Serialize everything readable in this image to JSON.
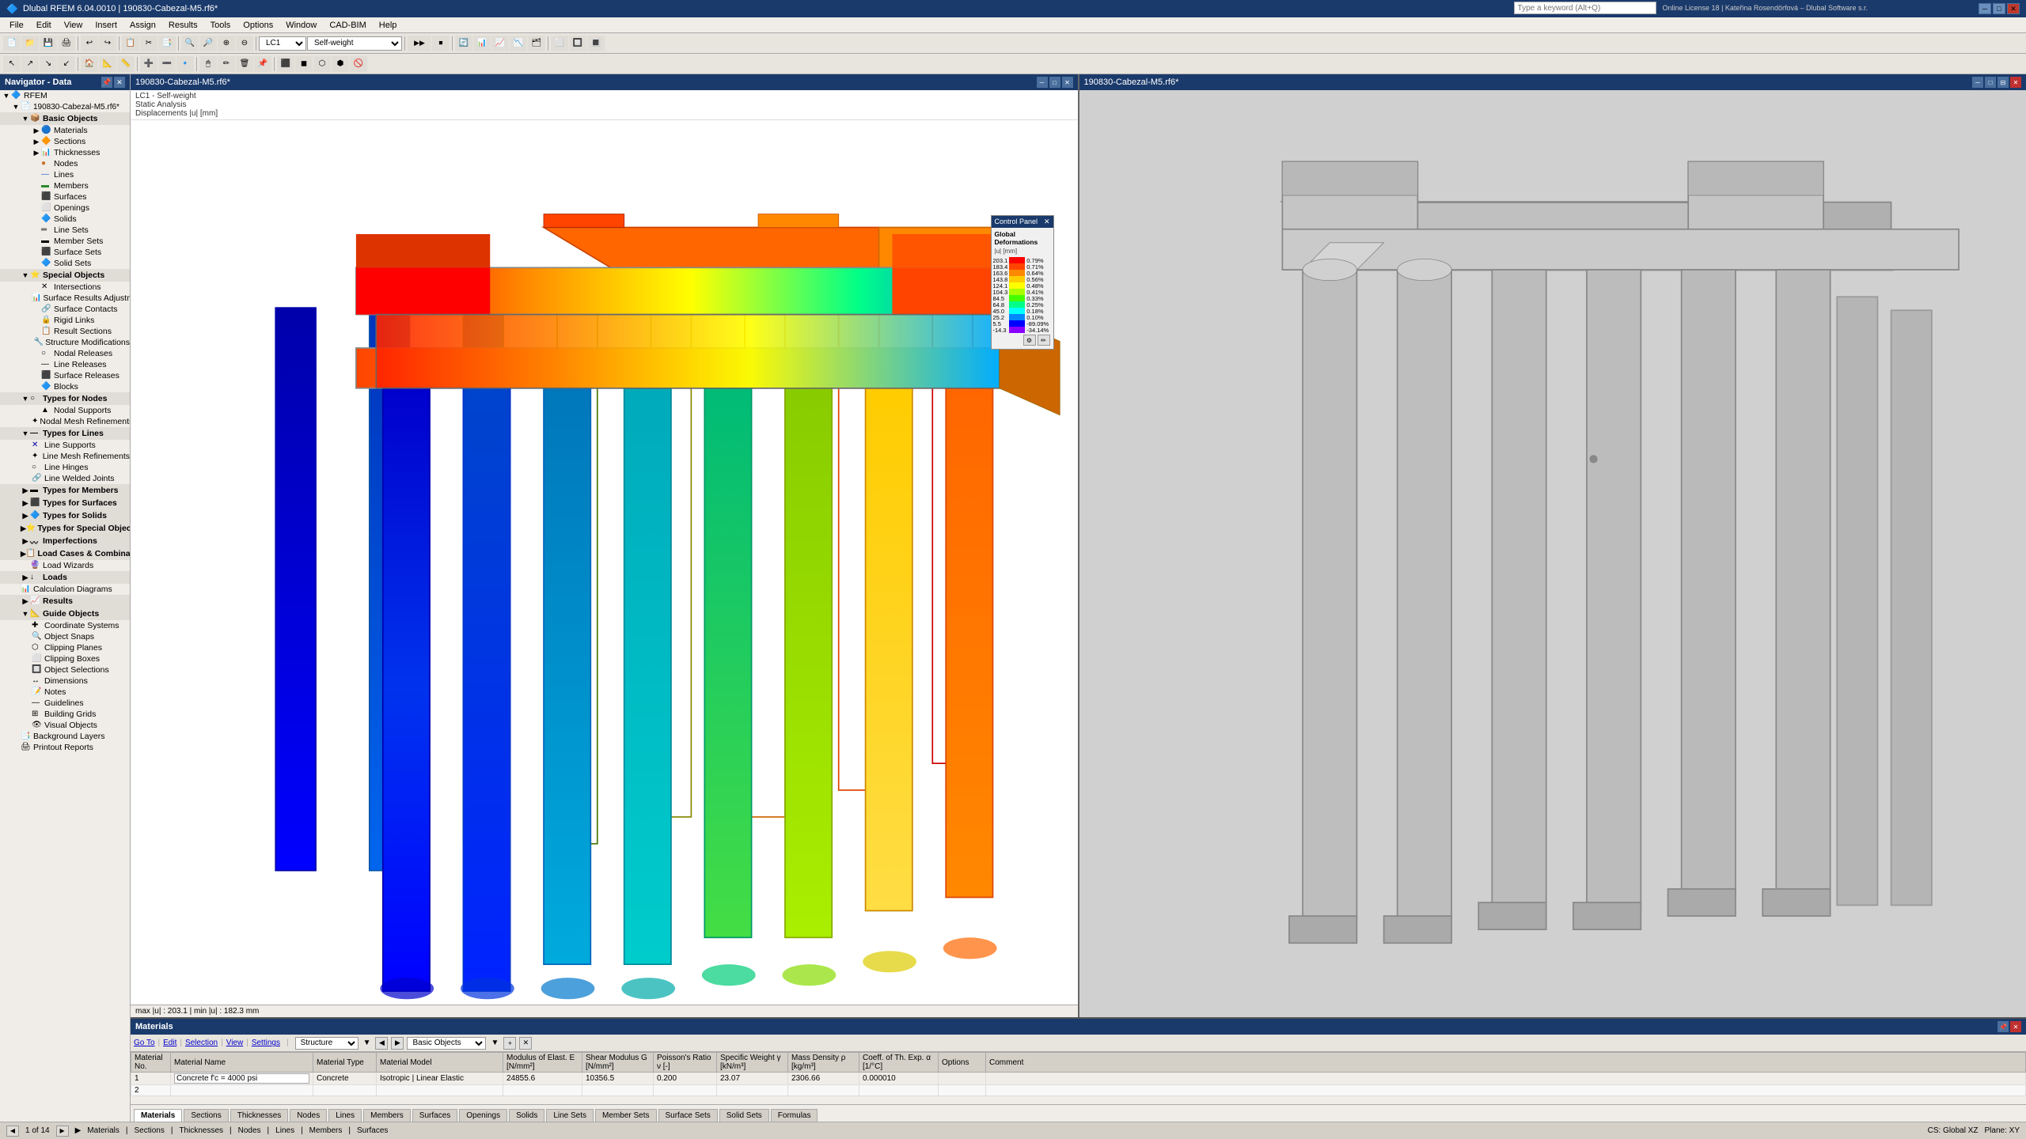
{
  "app": {
    "title": "Dlubal RFEM 6.04.0010 | 190830-Cabezal-M5.rf6*",
    "version": "Dlubal RFEM 6.04.0010"
  },
  "titlebar": {
    "minimize": "─",
    "maximize": "□",
    "close": "✕"
  },
  "menu": {
    "items": [
      "File",
      "Edit",
      "View",
      "Insert",
      "Assign",
      "Results",
      "Tools",
      "Options",
      "Window",
      "CAD-BIM",
      "Help"
    ]
  },
  "search": {
    "placeholder": "Type a keyword (Alt+Q)",
    "license": "Online License 18 | Kateřina Rosendörfová – Dlubal Software s.r."
  },
  "navigator": {
    "title": "Navigator - Data",
    "rfem_label": "RFEM",
    "file_label": "190830-Cabezal-M5.rf6*",
    "basic_objects": "Basic Objects",
    "tree_items": [
      {
        "id": "rfem",
        "label": "RFEM",
        "level": 0,
        "expanded": true,
        "type": "root"
      },
      {
        "id": "file",
        "label": "190830-Cabezal-M5.rf6*",
        "level": 1,
        "expanded": true,
        "type": "file"
      },
      {
        "id": "basic-objects",
        "label": "Basic Objects",
        "level": 2,
        "expanded": true,
        "type": "folder"
      },
      {
        "id": "materials",
        "label": "Materials",
        "level": 3,
        "expanded": false,
        "type": "item"
      },
      {
        "id": "sections",
        "label": "Sections",
        "level": 3,
        "expanded": false,
        "type": "item"
      },
      {
        "id": "thicknesses",
        "label": "Thicknesses",
        "level": 3,
        "expanded": false,
        "type": "item"
      },
      {
        "id": "nodes",
        "label": "Nodes",
        "level": 3,
        "expanded": false,
        "type": "item"
      },
      {
        "id": "lines",
        "label": "Lines",
        "level": 3,
        "expanded": false,
        "type": "item"
      },
      {
        "id": "members",
        "label": "Members",
        "level": 3,
        "expanded": false,
        "type": "item"
      },
      {
        "id": "surfaces",
        "label": "Surfaces",
        "level": 3,
        "expanded": false,
        "type": "item"
      },
      {
        "id": "openings",
        "label": "Openings",
        "level": 3,
        "expanded": false,
        "type": "item"
      },
      {
        "id": "solids",
        "label": "Solids",
        "level": 3,
        "expanded": false,
        "type": "item"
      },
      {
        "id": "line-sets",
        "label": "Line Sets",
        "level": 3,
        "expanded": false,
        "type": "item"
      },
      {
        "id": "member-sets",
        "label": "Member Sets",
        "level": 3,
        "expanded": false,
        "type": "item"
      },
      {
        "id": "surface-sets",
        "label": "Surface Sets",
        "level": 3,
        "expanded": false,
        "type": "item"
      },
      {
        "id": "solid-sets",
        "label": "Solid Sets",
        "level": 3,
        "expanded": false,
        "type": "item"
      },
      {
        "id": "special-objects",
        "label": "Special Objects",
        "level": 2,
        "expanded": true,
        "type": "folder"
      },
      {
        "id": "intersections",
        "label": "Intersections",
        "level": 3,
        "expanded": false,
        "type": "item"
      },
      {
        "id": "surface-results-adj",
        "label": "Surface Results Adjustments",
        "level": 3,
        "expanded": false,
        "type": "item"
      },
      {
        "id": "surface-contacts",
        "label": "Surface Contacts",
        "level": 3,
        "expanded": false,
        "type": "item"
      },
      {
        "id": "rigid-links",
        "label": "Rigid Links",
        "level": 3,
        "expanded": false,
        "type": "item"
      },
      {
        "id": "result-sections",
        "label": "Result Sections",
        "level": 3,
        "expanded": false,
        "type": "item"
      },
      {
        "id": "structure-mods",
        "label": "Structure Modifications",
        "level": 3,
        "expanded": false,
        "type": "item"
      },
      {
        "id": "nodal-releases",
        "label": "Nodal Releases",
        "level": 3,
        "expanded": false,
        "type": "item"
      },
      {
        "id": "line-releases",
        "label": "Line Releases",
        "level": 3,
        "expanded": false,
        "type": "item"
      },
      {
        "id": "surface-releases",
        "label": "Surface Releases",
        "level": 3,
        "expanded": false,
        "type": "item"
      },
      {
        "id": "blocks",
        "label": "Blocks",
        "level": 3,
        "expanded": false,
        "type": "item"
      },
      {
        "id": "types-for-nodes",
        "label": "Types for Nodes",
        "level": 2,
        "expanded": true,
        "type": "folder"
      },
      {
        "id": "nodal-supports",
        "label": "Nodal Supports",
        "level": 3,
        "expanded": false,
        "type": "item"
      },
      {
        "id": "nodal-mesh-ref",
        "label": "Nodal Mesh Refinements",
        "level": 3,
        "expanded": false,
        "type": "item"
      },
      {
        "id": "types-for-lines",
        "label": "Types for Lines",
        "level": 2,
        "expanded": true,
        "type": "folder"
      },
      {
        "id": "line-supports",
        "label": "Line Supports",
        "level": 3,
        "expanded": false,
        "type": "item"
      },
      {
        "id": "line-mesh-ref",
        "label": "Line Mesh Refinements",
        "level": 3,
        "expanded": false,
        "type": "item"
      },
      {
        "id": "line-hinges",
        "label": "Line Hinges",
        "level": 3,
        "expanded": false,
        "type": "item"
      },
      {
        "id": "line-welded-joints",
        "label": "Line Welded Joints",
        "level": 3,
        "expanded": false,
        "type": "item"
      },
      {
        "id": "types-for-members",
        "label": "Types for Members",
        "level": 2,
        "expanded": false,
        "type": "folder"
      },
      {
        "id": "types-for-surfaces",
        "label": "Types for Surfaces",
        "level": 2,
        "expanded": false,
        "type": "folder"
      },
      {
        "id": "types-for-solids",
        "label": "Types for Solids",
        "level": 2,
        "expanded": false,
        "type": "folder"
      },
      {
        "id": "types-for-special",
        "label": "Types for Special Objects",
        "level": 2,
        "expanded": false,
        "type": "folder"
      },
      {
        "id": "imperfections",
        "label": "Imperfections",
        "level": 2,
        "expanded": false,
        "type": "folder"
      },
      {
        "id": "load-cases",
        "label": "Load Cases & Combinations",
        "level": 2,
        "expanded": false,
        "type": "folder"
      },
      {
        "id": "load-wizards",
        "label": "Load Wizards",
        "level": 2,
        "expanded": false,
        "type": "item"
      },
      {
        "id": "loads",
        "label": "Loads",
        "level": 2,
        "expanded": false,
        "type": "folder"
      },
      {
        "id": "calc-diagrams",
        "label": "Calculation Diagrams",
        "level": 2,
        "expanded": false,
        "type": "item"
      },
      {
        "id": "results",
        "label": "Results",
        "level": 2,
        "expanded": false,
        "type": "folder"
      },
      {
        "id": "guide-objects",
        "label": "Guide Objects",
        "level": 2,
        "expanded": true,
        "type": "folder"
      },
      {
        "id": "coord-systems",
        "label": "Coordinate Systems",
        "level": 3,
        "expanded": false,
        "type": "item"
      },
      {
        "id": "object-snaps",
        "label": "Object Snaps",
        "level": 3,
        "expanded": false,
        "type": "item"
      },
      {
        "id": "clipping-planes",
        "label": "Clipping Planes",
        "level": 3,
        "expanded": false,
        "type": "item"
      },
      {
        "id": "clipping-boxes",
        "label": "Clipping Boxes",
        "level": 3,
        "expanded": false,
        "type": "item"
      },
      {
        "id": "object-selections",
        "label": "Object Selections",
        "level": 3,
        "expanded": false,
        "type": "item"
      },
      {
        "id": "dimensions",
        "label": "Dimensions",
        "level": 3,
        "expanded": false,
        "type": "item"
      },
      {
        "id": "notes",
        "label": "Notes",
        "level": 3,
        "expanded": false,
        "type": "item"
      },
      {
        "id": "guidelines",
        "label": "Guidelines",
        "level": 3,
        "expanded": false,
        "type": "item"
      },
      {
        "id": "building-grids",
        "label": "Building Grids",
        "level": 3,
        "expanded": false,
        "type": "item"
      },
      {
        "id": "visual-objects",
        "label": "Visual Objects",
        "level": 3,
        "expanded": false,
        "type": "item"
      },
      {
        "id": "background-layers",
        "label": "Background Layers",
        "level": 2,
        "expanded": false,
        "type": "item"
      },
      {
        "id": "printout-reports",
        "label": "Printout Reports",
        "level": 2,
        "expanded": false,
        "type": "item"
      }
    ]
  },
  "viewport_left": {
    "title": "190830-Cabezal-M5.rf6*",
    "lc": "LC1 - Self-weight",
    "analysis_type": "Static Analysis",
    "result_type": "Displacements |u| [mm]",
    "status": "max |u| : 203.1 | min |u| : 182.3 mm"
  },
  "viewport_right": {
    "title": "190830-Cabezal-M5.rf6*"
  },
  "control_panel": {
    "title": "Control Panel",
    "subtitle": "Global Deformations",
    "subtitle2": "|u| [mm]",
    "colors": [
      {
        "label": "203.1",
        "value": "0.79%",
        "color": "#ff0000"
      },
      {
        "label": "183.4",
        "value": "0.71%",
        "color": "#ff4400"
      },
      {
        "label": "163.6",
        "value": "0.64%",
        "color": "#ff8800"
      },
      {
        "label": "143.8",
        "value": "0.56%",
        "color": "#ffcc00"
      },
      {
        "label": "124.1",
        "value": "0.48%",
        "color": "#ffff00"
      },
      {
        "label": "104.3",
        "value": "0.41%",
        "color": "#aaff00"
      },
      {
        "label": "84.5",
        "value": "0.33%",
        "color": "#44ff00"
      },
      {
        "label": "64.8",
        "value": "0.25%",
        "color": "#00ff88"
      },
      {
        "label": "45.0",
        "value": "0.18%",
        "color": "#00ffff"
      },
      {
        "label": "25.2",
        "value": "0.10%",
        "color": "#0088ff"
      },
      {
        "label": "5.5",
        "value": "-89.09%",
        "color": "#0000ff"
      },
      {
        "label": "-14.3",
        "value": "-34.14%",
        "color": "#8800ff"
      }
    ]
  },
  "toolbar": {
    "lc_combo": "LC1",
    "lc_label": "Self-weight",
    "toolbar1_btns": [
      "📁",
      "💾",
      "🖨",
      "↩",
      "↪"
    ],
    "toolbar2_btns": [
      "▶",
      "⏸",
      "⏹"
    ]
  },
  "materials_panel": {
    "title": "Materials",
    "goto": "Go To",
    "edit": "Edit",
    "selection": "Selection",
    "view": "View",
    "settings": "Settings",
    "filter_combo": "Structure",
    "filter_combo2": "Basic Objects",
    "columns": [
      "Material No.",
      "Material Name",
      "Material Type",
      "Material Model",
      "Modulus of Elast. E [N/mm²]",
      "Shear Modulus G [N/mm²]",
      "Poisson's Ratio ν [-]",
      "Specific Weight γ [kN/m³]",
      "Mass Density ρ [kg/m³]",
      "Coeff. of Th. Exp. α [1/°C]",
      "Options",
      "Comment"
    ],
    "rows": [
      {
        "no": "1",
        "name": "Concrete f'c = 4000 psi",
        "type": "Concrete",
        "model": "Isotropic | Linear Elastic",
        "E": "24855.6",
        "G": "10356.5",
        "nu": "0.200",
        "gamma": "23.07",
        "rho": "2306.66",
        "alpha": "0.000010",
        "options": "",
        "comment": ""
      },
      {
        "no": "2",
        "name": "",
        "type": "",
        "model": "",
        "E": "",
        "G": "",
        "nu": "",
        "gamma": "",
        "rho": "",
        "alpha": "",
        "options": "",
        "comment": ""
      }
    ]
  },
  "bottom_tabs": {
    "items": [
      "Materials",
      "Sections",
      "Thicknesses",
      "Nodes",
      "Lines",
      "Members",
      "Surfaces",
      "Openings",
      "Solids",
      "Line Sets",
      "Member Sets",
      "Surface Sets",
      "Solid Sets",
      "Formulas"
    ],
    "active": "Materials"
  },
  "status_bar": {
    "pagination": "1 of 14",
    "plane": "CS: Global XZ",
    "view_plane": "Plane: XY"
  }
}
